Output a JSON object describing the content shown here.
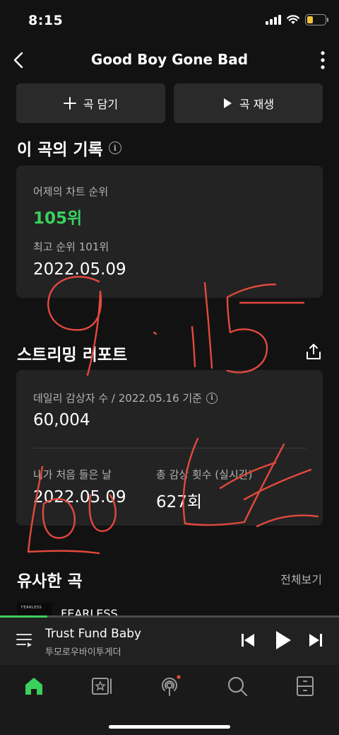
{
  "status": {
    "time": "8:15"
  },
  "header": {
    "title": "Good Boy Gone Bad"
  },
  "actions": {
    "add_label": "곡 담기",
    "play_label": "곡 재생"
  },
  "history": {
    "title": "이 곡의 기록",
    "yesterday_label": "어제의 차트 순위",
    "yesterday_rank": "105위",
    "peak_label": "최고 순위 101위",
    "peak_date": "2022.05.09",
    "rank_color": "#3ad05e"
  },
  "streaming": {
    "title": "스트리밍 리포트",
    "daily_label": "데일리 감상자 수 / 2022.05.16 기준",
    "daily_value": "60,004",
    "first_listen_label": "내가 처음 들은 날",
    "first_listen_value": "2022.05.09",
    "total_plays_label": "총 감상 횟수 (실시간)",
    "total_plays_value": "627회"
  },
  "similar": {
    "title": "유사한 곡",
    "see_all": "전체보기",
    "items": [
      {
        "album_art_text": "FEARLESS",
        "title": "FEARLESS"
      }
    ]
  },
  "now_playing": {
    "title": "Trust Fund Baby",
    "artist": "투모로우바이투게더",
    "progress": 0.14
  },
  "nav": {
    "items": [
      "home-icon",
      "library-icon",
      "podcast-icon",
      "search-icon",
      "storage-icon"
    ],
    "active": "home-icon",
    "accent": "#3ad05e"
  },
  "annotation": {
    "color": "#e3493d"
  }
}
